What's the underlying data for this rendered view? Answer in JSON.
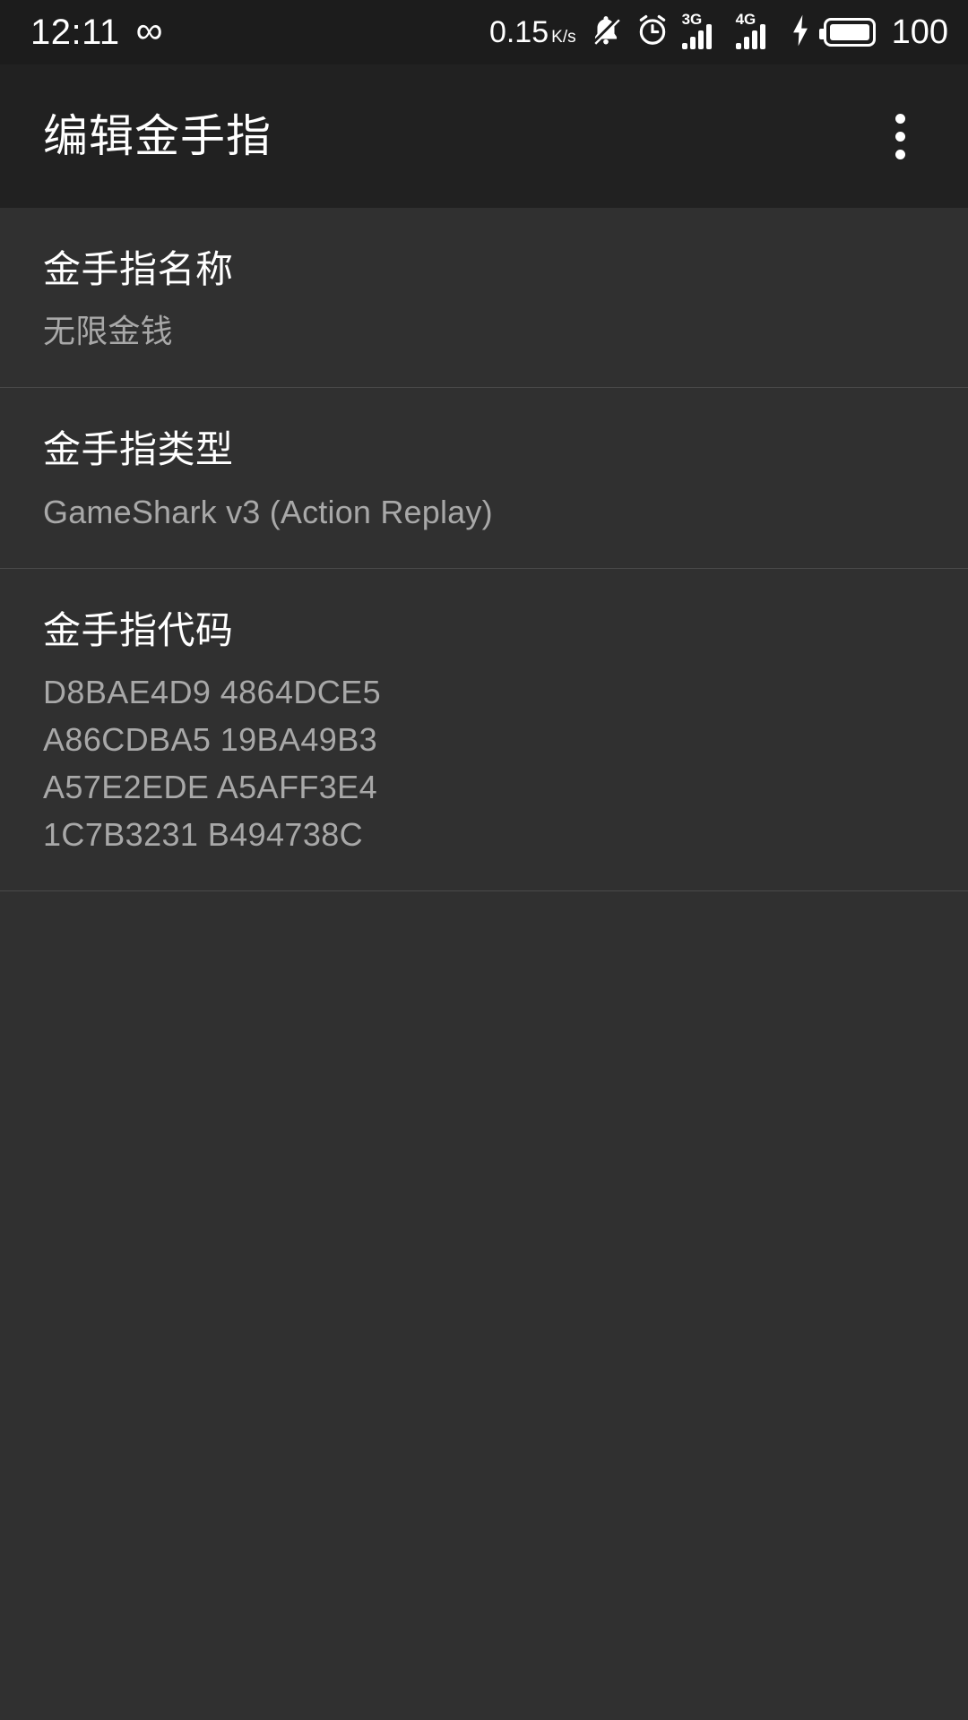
{
  "statusbar": {
    "time": "12:11",
    "infinity_glyph": "∞",
    "network_speed": "0.15",
    "network_speed_unit": "K/s",
    "signal_1_gen": "3G",
    "signal_2_gen": "4G",
    "battery_level": "100",
    "icons": [
      "infinity-icon",
      "silent-bell-icon",
      "alarm-clock-icon",
      "signal-3g-icon",
      "signal-4g-icon",
      "charging-bolt-icon",
      "battery-icon"
    ]
  },
  "appbar": {
    "title": "编辑金手指",
    "overflow_label": "more-options"
  },
  "preferences": [
    {
      "title": "金手指名称",
      "summary": "无限金钱"
    },
    {
      "title": "金手指类型",
      "summary": "GameShark v3 (Action Replay)"
    }
  ],
  "cheat_code": {
    "title": "金手指代码",
    "lines": [
      "D8BAE4D9 4864DCE5",
      "A86CDBA5 19BA49B3",
      "A57E2EDE A5AFF3E4",
      "1C7B3231 B494738C"
    ]
  },
  "colors": {
    "statusbar_bg": "#1c1c1c",
    "appbar_bg": "#212121",
    "content_bg": "#303030",
    "divider": "#4a4a4a",
    "primary_text": "#ffffff",
    "secondary_text": "#a8a8a8"
  }
}
